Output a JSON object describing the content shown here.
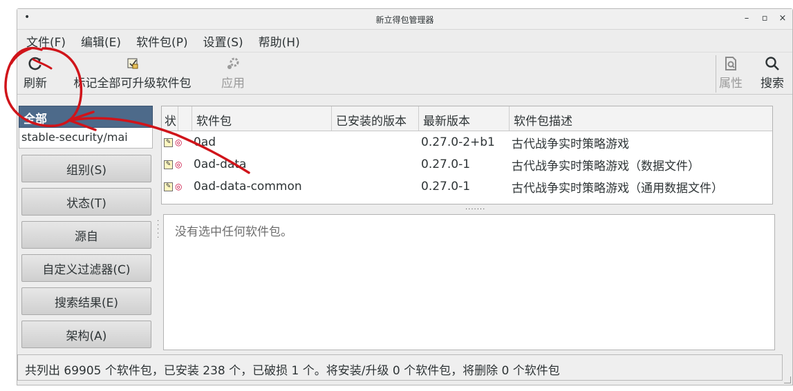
{
  "window": {
    "title": "新立得包管理器",
    "controls": [
      "minimize-icon",
      "maximize-icon",
      "close-icon"
    ]
  },
  "menubar": {
    "items": [
      "文件(F)",
      "编辑(E)",
      "软件包(P)",
      "设置(S)",
      "帮助(H)"
    ]
  },
  "toolbar": {
    "reload_label": "刷新",
    "mark_all_label": "标记全部可升级软件包",
    "apply_label": "应用",
    "properties_label": "属性",
    "search_label": "搜索"
  },
  "filters": {
    "selected": "全部",
    "repo": "stable-security/mai"
  },
  "left_buttons": [
    "组别(S)",
    "状态(T)",
    "源自",
    "自定义过滤器(C)",
    "搜索结果(E)",
    "架构(A)"
  ],
  "table": {
    "columns": [
      "状",
      "软件包",
      "已安装的版本",
      "最新版本",
      "软件包描述"
    ],
    "rows": [
      {
        "name": "0ad",
        "installed": "",
        "latest": "0.27.0-2+b1",
        "description": "古代战争实时策略游戏"
      },
      {
        "name": "0ad-data",
        "installed": "",
        "latest": "0.27.0-1",
        "description": "古代战争实时策略游戏（数据文件）"
      },
      {
        "name": "0ad-data-common",
        "installed": "",
        "latest": "0.27.0-1",
        "description": "古代战争实时策略游戏（通用数据文件）"
      }
    ]
  },
  "description_panel": {
    "text": "没有选中任何软件包。"
  },
  "statusbar": {
    "text": "共列出 69905 个软件包，已安装 238 个，已破损 1 个。将安装/升级 0 个软件包，将删除 0 个软件包"
  },
  "colors": {
    "selected_filter_bg": "#4d6a8a",
    "annotation": "#d0141a"
  }
}
